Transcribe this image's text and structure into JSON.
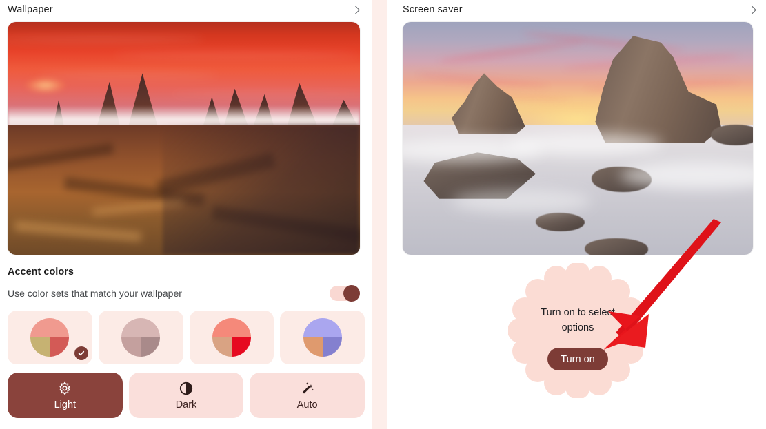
{
  "left_pane": {
    "header": {
      "title": "Wallpaper",
      "chevron_icon": "chevron-right-icon"
    },
    "preview": {
      "alt": "mountain-sunset-wallpaper-preview"
    },
    "accent": {
      "heading": "Accent colors",
      "subtitle": "Use color sets that match your wallpaper",
      "toggle_state": "on",
      "swatches": [
        {
          "name": "swatch-1",
          "selected": true,
          "top": "#f09a8f",
          "bottom_left": "#c6b272",
          "bottom_right": "#d35a56"
        },
        {
          "name": "swatch-2",
          "selected": false,
          "top": "#d7b6b4",
          "bottom_left": "#c4a09e",
          "bottom_right": "#a98a8a"
        },
        {
          "name": "swatch-3",
          "selected": false,
          "top": "#f5897a",
          "bottom_left": "#d9a383",
          "bottom_right": "#e60a20"
        },
        {
          "name": "swatch-4",
          "selected": false,
          "top": "#aaa6ef",
          "bottom_left": "#df9a6e",
          "bottom_right": "#8480cf"
        }
      ],
      "check_icon": "check-circle-icon"
    },
    "modes": [
      {
        "label": "Light",
        "icon": "sun-icon",
        "active": true
      },
      {
        "label": "Dark",
        "icon": "contrast-icon",
        "active": false
      },
      {
        "label": "Auto",
        "icon": "magic-wand-icon",
        "active": false
      }
    ]
  },
  "right_pane": {
    "header": {
      "title": "Screen saver",
      "chevron_icon": "chevron-right-icon"
    },
    "preview": {
      "alt": "sea-stacks-sunset-screensaver-preview"
    },
    "callout": {
      "message": "Turn on to select options",
      "button_label": "Turn on",
      "background": "#fbdcd4"
    }
  },
  "annotation": {
    "arrow_icon": "red-arrow-icon",
    "color": "#e8151b"
  },
  "theme": {
    "accent_dark": "#7d3c36",
    "surface_pink": "#fadfdb",
    "tile_pink": "#fcebe6",
    "divider_pink": "#fdeeea",
    "text_primary": "#1f1f1f",
    "text_secondary": "#44474a"
  }
}
